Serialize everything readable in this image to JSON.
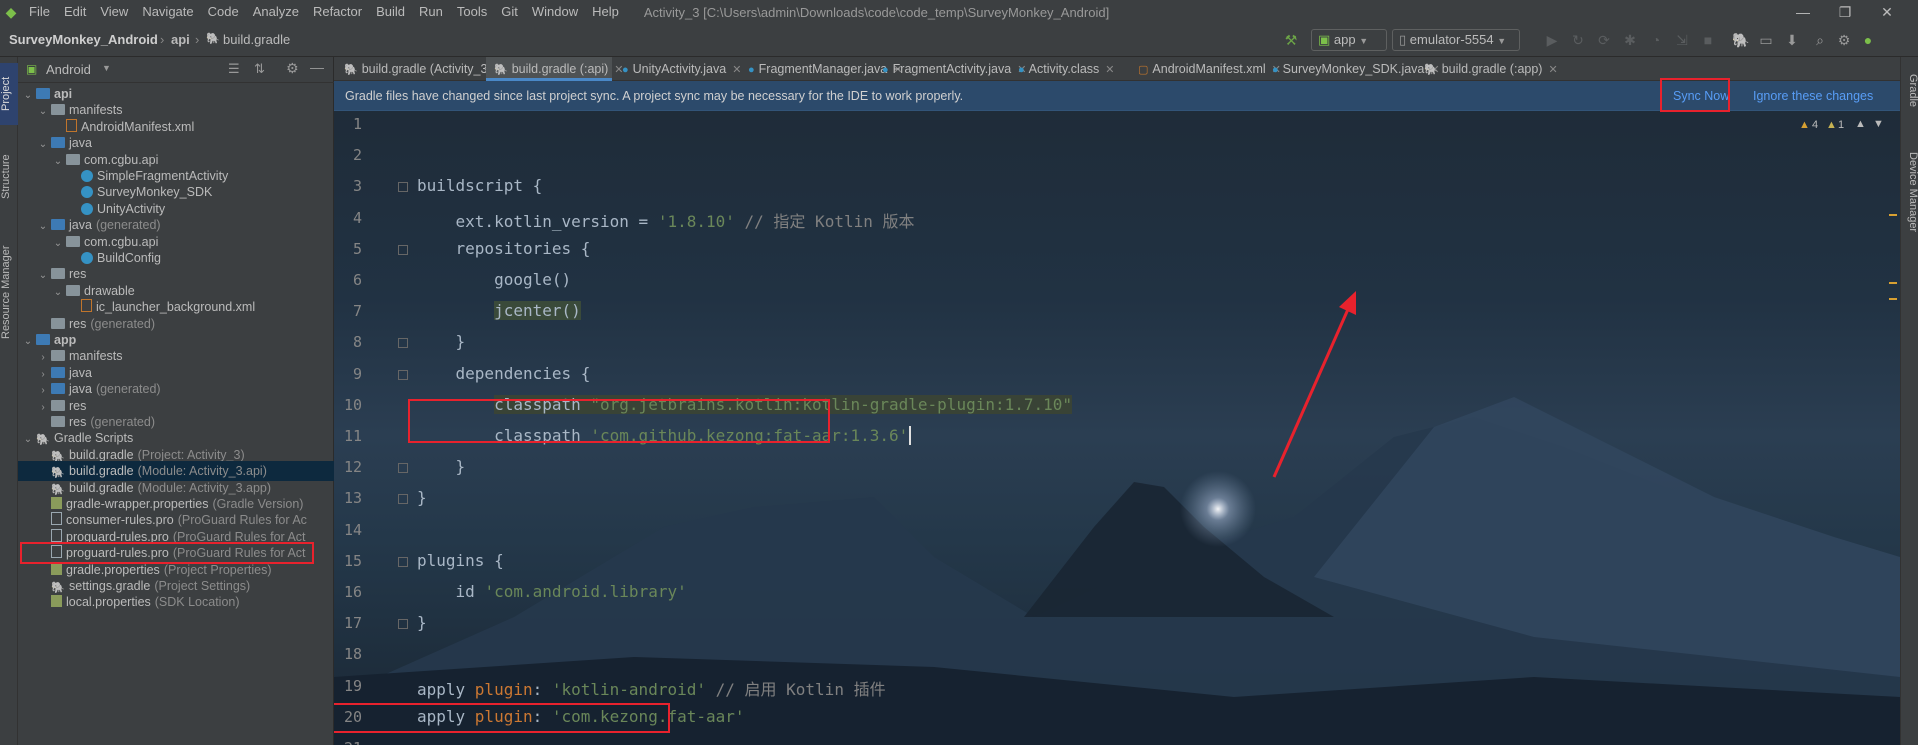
{
  "menubar": {
    "items": [
      "File",
      "Edit",
      "View",
      "Navigate",
      "Code",
      "Analyze",
      "Refactor",
      "Build",
      "Run",
      "Tools",
      "Git",
      "Window",
      "Help"
    ],
    "title": "Activity_3 [C:\\Users\\admin\\Downloads\\code\\code_temp\\SurveyMonkey_Android]"
  },
  "navbar": {
    "crumbs": [
      "SurveyMonkey_Android",
      "api",
      "build.gradle"
    ],
    "run_config": "app",
    "device": "emulator-5554"
  },
  "sidebar_tabs": {
    "project": "Project",
    "structure": "Structure",
    "resource_manager": "Resource Manager"
  },
  "right_tabs": {
    "gradle": "Gradle",
    "device_manager": "Device Manager"
  },
  "project_panel": {
    "view_mode": "Android",
    "tree": [
      {
        "label": "api",
        "extra": "",
        "depth": 0,
        "icon": "module-folder",
        "expanded": true,
        "bold": true
      },
      {
        "label": "manifests",
        "extra": "",
        "depth": 1,
        "icon": "folder",
        "expanded": true
      },
      {
        "label": "AndroidManifest.xml",
        "extra": "",
        "depth": 2,
        "icon": "xml-file",
        "expanded": null
      },
      {
        "label": "java",
        "extra": "",
        "depth": 1,
        "icon": "folder-blue",
        "expanded": true
      },
      {
        "label": "com.cgbu.api",
        "extra": "",
        "depth": 2,
        "icon": "package",
        "expanded": true
      },
      {
        "label": "SimpleFragmentActivity",
        "extra": "",
        "depth": 3,
        "icon": "class",
        "expanded": null
      },
      {
        "label": "SurveyMonkey_SDK",
        "extra": "",
        "depth": 3,
        "icon": "class",
        "expanded": null
      },
      {
        "label": "UnityActivity",
        "extra": "",
        "depth": 3,
        "icon": "class",
        "expanded": null
      },
      {
        "label": "java",
        "extra": "(generated)",
        "depth": 1,
        "icon": "folder-blue",
        "expanded": true
      },
      {
        "label": "com.cgbu.api",
        "extra": "",
        "depth": 2,
        "icon": "package",
        "expanded": true
      },
      {
        "label": "BuildConfig",
        "extra": "",
        "depth": 3,
        "icon": "class",
        "expanded": null
      },
      {
        "label": "res",
        "extra": "",
        "depth": 1,
        "icon": "folder",
        "expanded": true
      },
      {
        "label": "drawable",
        "extra": "",
        "depth": 2,
        "icon": "folder",
        "expanded": true
      },
      {
        "label": "ic_launcher_background.xml",
        "extra": "",
        "depth": 3,
        "icon": "xml-file",
        "expanded": null
      },
      {
        "label": "res",
        "extra": "(generated)",
        "depth": 1,
        "icon": "folder",
        "expanded": null
      },
      {
        "label": "app",
        "extra": "",
        "depth": 0,
        "icon": "module-folder",
        "expanded": true,
        "bold": true
      },
      {
        "label": "manifests",
        "extra": "",
        "depth": 1,
        "icon": "folder",
        "expanded": false
      },
      {
        "label": "java",
        "extra": "",
        "depth": 1,
        "icon": "folder-blue",
        "expanded": false
      },
      {
        "label": "java",
        "extra": "(generated)",
        "depth": 1,
        "icon": "folder-blue",
        "expanded": false
      },
      {
        "label": "res",
        "extra": "",
        "depth": 1,
        "icon": "folder",
        "expanded": false
      },
      {
        "label": "res",
        "extra": "(generated)",
        "depth": 1,
        "icon": "folder",
        "expanded": null
      },
      {
        "label": "Gradle Scripts",
        "extra": "",
        "depth": 0,
        "icon": "gradle",
        "expanded": true
      },
      {
        "label": "build.gradle",
        "extra": "(Project: Activity_3)",
        "depth": 1,
        "icon": "gradle",
        "expanded": null
      },
      {
        "label": "build.gradle",
        "extra": "(Module: Activity_3.api)",
        "depth": 1,
        "icon": "gradle",
        "expanded": null,
        "selected": true
      },
      {
        "label": "build.gradle",
        "extra": "(Module: Activity_3.app)",
        "depth": 1,
        "icon": "gradle",
        "expanded": null
      },
      {
        "label": "gradle-wrapper.properties",
        "extra": "(Gradle Version)",
        "depth": 1,
        "icon": "props",
        "expanded": null
      },
      {
        "label": "consumer-rules.pro",
        "extra": "(ProGuard Rules for Ac",
        "depth": 1,
        "icon": "pro-file",
        "expanded": null
      },
      {
        "label": "proguard-rules.pro",
        "extra": "(ProGuard Rules for Act",
        "depth": 1,
        "icon": "pro-file",
        "expanded": null
      },
      {
        "label": "proguard-rules.pro",
        "extra": "(ProGuard Rules for Act",
        "depth": 1,
        "icon": "pro-file",
        "expanded": null
      },
      {
        "label": "gradle.properties",
        "extra": "(Project Properties)",
        "depth": 1,
        "icon": "props",
        "expanded": null
      },
      {
        "label": "settings.gradle",
        "extra": "(Project Settings)",
        "depth": 1,
        "icon": "gradle",
        "expanded": null
      },
      {
        "label": "local.properties",
        "extra": "(SDK Location)",
        "depth": 1,
        "icon": "props",
        "expanded": null
      }
    ]
  },
  "editor_tabs": [
    {
      "label": "build.gradle (Activity_3)",
      "icon": "gradle",
      "active": false
    },
    {
      "label": "build.gradle (:api)",
      "icon": "gradle",
      "active": true
    },
    {
      "label": "UnityActivity.java",
      "icon": "class",
      "active": false
    },
    {
      "label": "FragmentManager.java",
      "icon": "class",
      "active": false
    },
    {
      "label": "FragmentActivity.java",
      "icon": "class",
      "active": false
    },
    {
      "label": "Activity.class",
      "icon": "class",
      "active": false
    },
    {
      "label": "AndroidManifest.xml",
      "icon": "xml-file",
      "active": false
    },
    {
      "label": "SurveyMonkey_SDK.java",
      "icon": "class",
      "active": false
    },
    {
      "label": "build.gradle (:app)",
      "icon": "gradle",
      "active": false
    }
  ],
  "notification": {
    "message": "Gradle files have changed since last project sync. A project sync may be necessary for the IDE to work properly.",
    "sync_now": "Sync Now",
    "ignore": "Ignore these changes"
  },
  "inspections": {
    "warnings": "4",
    "weak_warnings": "1"
  },
  "code_lines": [
    {
      "n": "1",
      "tokens": []
    },
    {
      "n": "2",
      "tokens": []
    },
    {
      "n": "3",
      "tokens": [
        {
          "t": "buildscript {",
          "c": "plain"
        }
      ]
    },
    {
      "n": "4",
      "tokens": [
        {
          "t": "    ext.kotlin_version = ",
          "c": "plain"
        },
        {
          "t": "'1.8.10'",
          "c": "str"
        },
        {
          "t": " // 指定 Kotlin 版本",
          "c": "cm"
        }
      ]
    },
    {
      "n": "5",
      "tokens": [
        {
          "t": "    repositories {",
          "c": "plain"
        }
      ]
    },
    {
      "n": "6",
      "tokens": [
        {
          "t": "        google()",
          "c": "plain"
        }
      ]
    },
    {
      "n": "7",
      "tokens": [
        {
          "t": "        ",
          "c": "plain"
        },
        {
          "t": "jcenter()",
          "c": "hl"
        }
      ]
    },
    {
      "n": "8",
      "tokens": [
        {
          "t": "    }",
          "c": "plain"
        }
      ]
    },
    {
      "n": "9",
      "tokens": [
        {
          "t": "    dependencies {",
          "c": "plain"
        }
      ]
    },
    {
      "n": "10",
      "tokens": [
        {
          "t": "        ",
          "c": "plain"
        },
        {
          "t": "classpath ",
          "c": "hl2"
        },
        {
          "t": "\"org.jetbrains.kotlin:kotlin-gradle-plugin:1.7.10\"",
          "c": "hlstr"
        }
      ]
    },
    {
      "n": "11",
      "tokens": [
        {
          "t": "        classpath ",
          "c": "plain"
        },
        {
          "t": "'com.github.kezong:fat-aar:1.3.6'",
          "c": "str"
        }
      ]
    },
    {
      "n": "12",
      "tokens": [
        {
          "t": "    }",
          "c": "plain"
        }
      ]
    },
    {
      "n": "13",
      "tokens": [
        {
          "t": "}",
          "c": "plain"
        }
      ]
    },
    {
      "n": "14",
      "tokens": []
    },
    {
      "n": "15",
      "tokens": [
        {
          "t": "plugins {",
          "c": "plain"
        }
      ]
    },
    {
      "n": "16",
      "tokens": [
        {
          "t": "    id ",
          "c": "plain"
        },
        {
          "t": "'com.android.library'",
          "c": "str"
        }
      ]
    },
    {
      "n": "17",
      "tokens": [
        {
          "t": "}",
          "c": "plain"
        }
      ]
    },
    {
      "n": "18",
      "tokens": []
    },
    {
      "n": "19",
      "tokens": [
        {
          "t": "apply ",
          "c": "plain"
        },
        {
          "t": "plugin",
          "c": "kw"
        },
        {
          "t": ": ",
          "c": "plain"
        },
        {
          "t": "'kotlin-android'",
          "c": "str"
        },
        {
          "t": " // 启用 Kotlin 插件",
          "c": "cm"
        }
      ]
    },
    {
      "n": "20",
      "tokens": [
        {
          "t": "apply ",
          "c": "plain"
        },
        {
          "t": "plugin",
          "c": "kw"
        },
        {
          "t": ": ",
          "c": "plain"
        },
        {
          "t": "'com.kezong.fat-aar'",
          "c": "str"
        }
      ]
    },
    {
      "n": "21",
      "tokens": []
    }
  ],
  "colors": {
    "annotation": "#e8222d",
    "accent": "#4a88c7",
    "link": "#589df6"
  }
}
